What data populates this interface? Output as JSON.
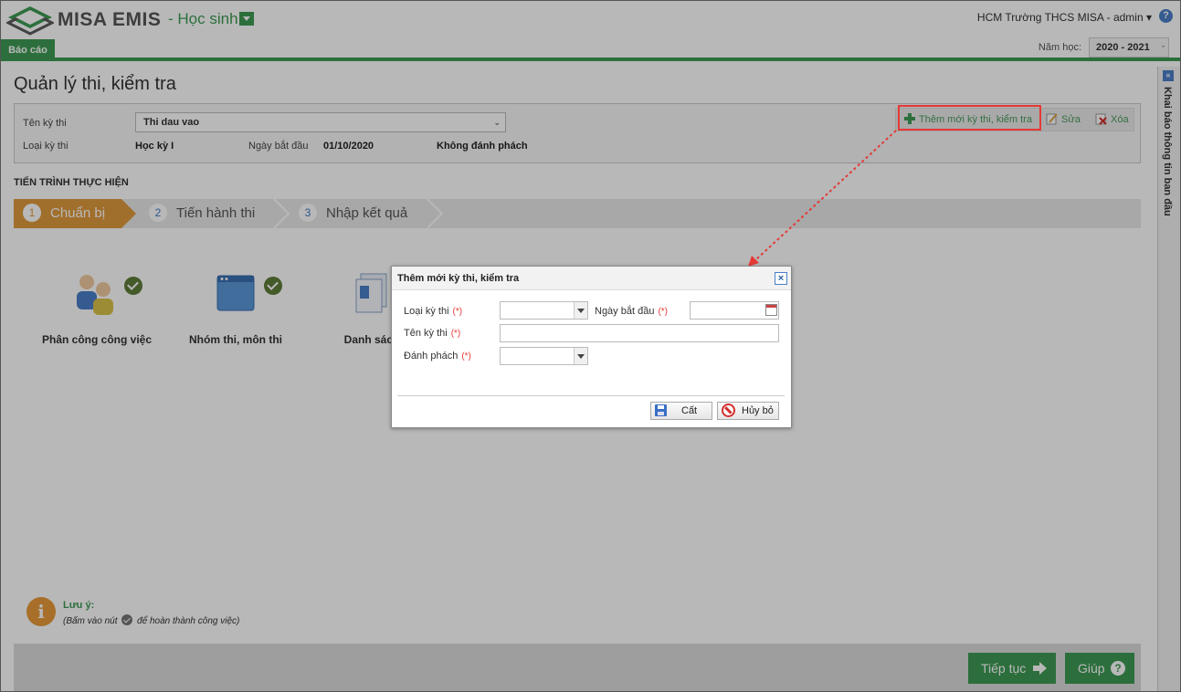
{
  "header": {
    "logo_text": "MISA EMIS",
    "module": "Học sinh",
    "user": "HCM Trường THCS MISA - admin",
    "user_caret": "▾",
    "help": "?"
  },
  "tabs": {
    "active": "Báo cáo"
  },
  "year": {
    "label": "Năm học:",
    "value": "2020 - 2021",
    "caret": "ˇ"
  },
  "page": {
    "title": "Quản lý thi, kiểm tra",
    "info": {
      "exam_name_label": "Tên kỳ thi",
      "exam_name_value": "Thi dau vao",
      "exam_type_label": "Loại kỳ thi",
      "exam_type_value": "Học kỳ I",
      "start_date_label": "Ngày bắt đầu",
      "start_date_value": "01/10/2020",
      "anonymize_value": "Không đánh phách"
    },
    "toolbar": {
      "add": "Thêm mới kỳ thi, kiểm tra",
      "edit": "Sửa",
      "delete": "Xóa"
    },
    "process_title": "TIẾN TRÌNH THỰC HIỆN",
    "steps": [
      {
        "num": "1",
        "label": "Chuẩn bị"
      },
      {
        "num": "2",
        "label": "Tiến hành thi"
      },
      {
        "num": "3",
        "label": "Nhập kết quả"
      }
    ],
    "tasks": [
      {
        "label": "Phân công công việc"
      },
      {
        "label": "Nhóm thi, môn thi"
      },
      {
        "label": "Danh sách thí"
      }
    ],
    "note": {
      "icon": "i",
      "title": "Lưu ý:",
      "text_before": "(Bấm vào nút",
      "text_after": "để hoàn thành công việc)"
    },
    "footer": {
      "next": "Tiếp tục",
      "help": "Giúp"
    }
  },
  "right_panel": {
    "label": "Khai báo thông tin ban đầu",
    "collapse": "«"
  },
  "dialog": {
    "title": "Thêm mới kỳ thi, kiểm tra",
    "close": "×",
    "required_mark": "(*)",
    "fields": {
      "exam_type": "Loại kỳ thi",
      "start_date": "Ngày bắt đầu",
      "exam_name": "Tên kỳ thi",
      "anonymize": "Đánh phách"
    },
    "buttons": {
      "save": "Cất",
      "cancel": "Hủy bỏ"
    }
  },
  "colors": {
    "brand_green": "#3d9a54",
    "step_active": "#e09a3e",
    "highlight_red": "#e53935"
  },
  "icons": [
    "logo-icon",
    "module-dropdown-icon",
    "help-icon",
    "add-icon",
    "edit-icon",
    "delete-icon",
    "check-icon",
    "info-icon",
    "arrow-right-icon",
    "question-icon",
    "calendar-icon",
    "save-icon",
    "cancel-icon",
    "close-icon",
    "collapse-icon"
  ]
}
